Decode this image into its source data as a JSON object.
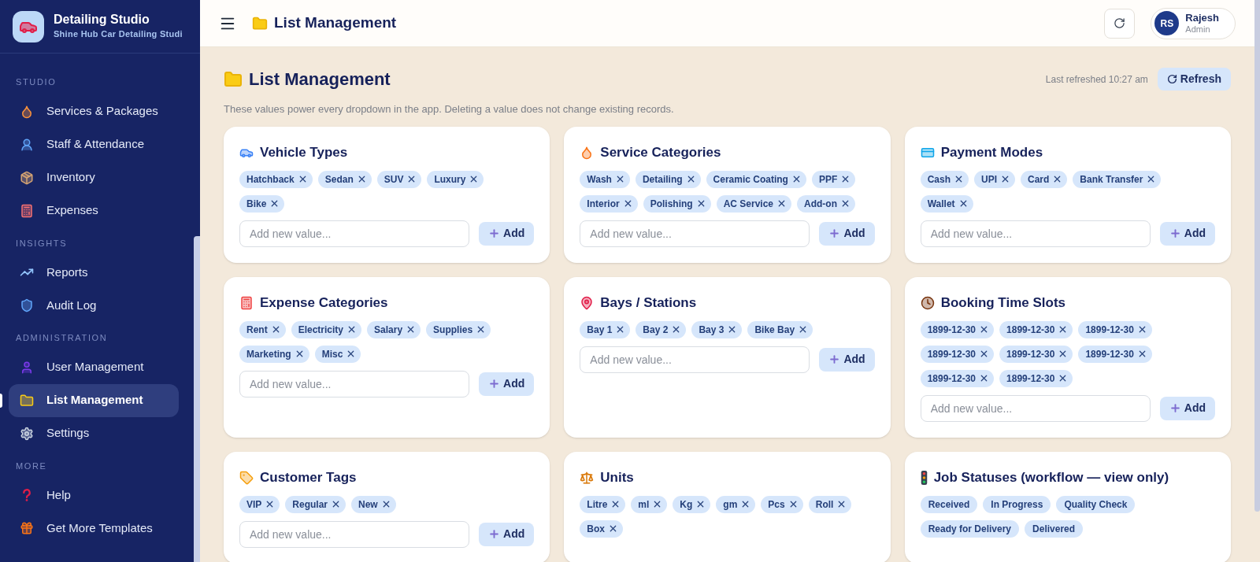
{
  "brand": {
    "title": "Detailing Studio",
    "subtitle": "Shine Hub Car Detailing Studi"
  },
  "sidebar": {
    "sections": [
      {
        "heading": "STUDIO",
        "items": [
          {
            "label": "Services & Packages",
            "selected": false
          },
          {
            "label": "Staff & Attendance",
            "selected": false
          },
          {
            "label": "Inventory",
            "selected": false
          },
          {
            "label": "Expenses",
            "selected": false
          }
        ]
      },
      {
        "heading": "INSIGHTS",
        "items": [
          {
            "label": "Reports",
            "selected": false
          },
          {
            "label": "Audit Log",
            "selected": false
          }
        ]
      },
      {
        "heading": "ADMINISTRATION",
        "items": [
          {
            "label": "User Management",
            "selected": false
          },
          {
            "label": "List Management",
            "selected": true
          },
          {
            "label": "Settings",
            "selected": false
          }
        ]
      },
      {
        "heading": "MORE",
        "items": [
          {
            "label": "Help",
            "selected": false
          },
          {
            "label": "Get More Templates",
            "selected": false
          }
        ]
      }
    ]
  },
  "header": {
    "title": "List Management",
    "user": {
      "initials": "RS",
      "name": "Rajesh",
      "role": "Admin"
    }
  },
  "page": {
    "title": "List Management",
    "last_refreshed": "Last refreshed 10:27 am",
    "refresh_button": "Refresh",
    "description": "These values power every dropdown in the app. Deleting a value does not change existing records."
  },
  "cards": [
    {
      "title": "Vehicle Types",
      "kind": "editable",
      "values": [
        "Hatchback",
        "Sedan",
        "SUV",
        "Luxury",
        "Bike"
      ],
      "placeholder": "Add new value...",
      "add_button": "Add"
    },
    {
      "title": "Service Categories",
      "kind": "editable",
      "values": [
        "Wash",
        "Detailing",
        "Ceramic Coating",
        "PPF",
        "Interior",
        "Polishing",
        "AC Service",
        "Add-on"
      ],
      "placeholder": "Add new value...",
      "add_button": "Add"
    },
    {
      "title": "Payment Modes",
      "kind": "editable",
      "values": [
        "Cash",
        "UPI",
        "Card",
        "Bank Transfer",
        "Wallet"
      ],
      "placeholder": "Add new value...",
      "add_button": "Add"
    },
    {
      "title": "Expense Categories",
      "kind": "editable",
      "values": [
        "Rent",
        "Electricity",
        "Salary",
        "Supplies",
        "Marketing",
        "Misc"
      ],
      "placeholder": "Add new value...",
      "add_button": "Add"
    },
    {
      "title": "Bays / Stations",
      "kind": "editable",
      "values": [
        "Bay 1",
        "Bay 2",
        "Bay 3",
        "Bike Bay"
      ],
      "placeholder": "Add new value...",
      "add_button": "Add"
    },
    {
      "title": "Booking Time Slots",
      "kind": "editable",
      "values": [
        "1899-12-30",
        "1899-12-30",
        "1899-12-30",
        "1899-12-30",
        "1899-12-30",
        "1899-12-30",
        "1899-12-30",
        "1899-12-30"
      ],
      "placeholder": "Add new value...",
      "add_button": "Add"
    },
    {
      "title": "Customer Tags",
      "kind": "editable",
      "values": [
        "VIP",
        "Regular",
        "New"
      ],
      "placeholder": "Add new value...",
      "add_button": "Add"
    },
    {
      "title": "Units",
      "kind": "editable",
      "values": [
        "Litre",
        "ml",
        "Kg",
        "gm",
        "Pcs",
        "Roll",
        "Box"
      ]
    },
    {
      "title": "Job Statuses (workflow — view only)",
      "kind": "view_only",
      "values": [
        "Received",
        "In Progress",
        "Quality Check",
        "Ready for Delivery",
        "Delivered"
      ]
    }
  ]
}
